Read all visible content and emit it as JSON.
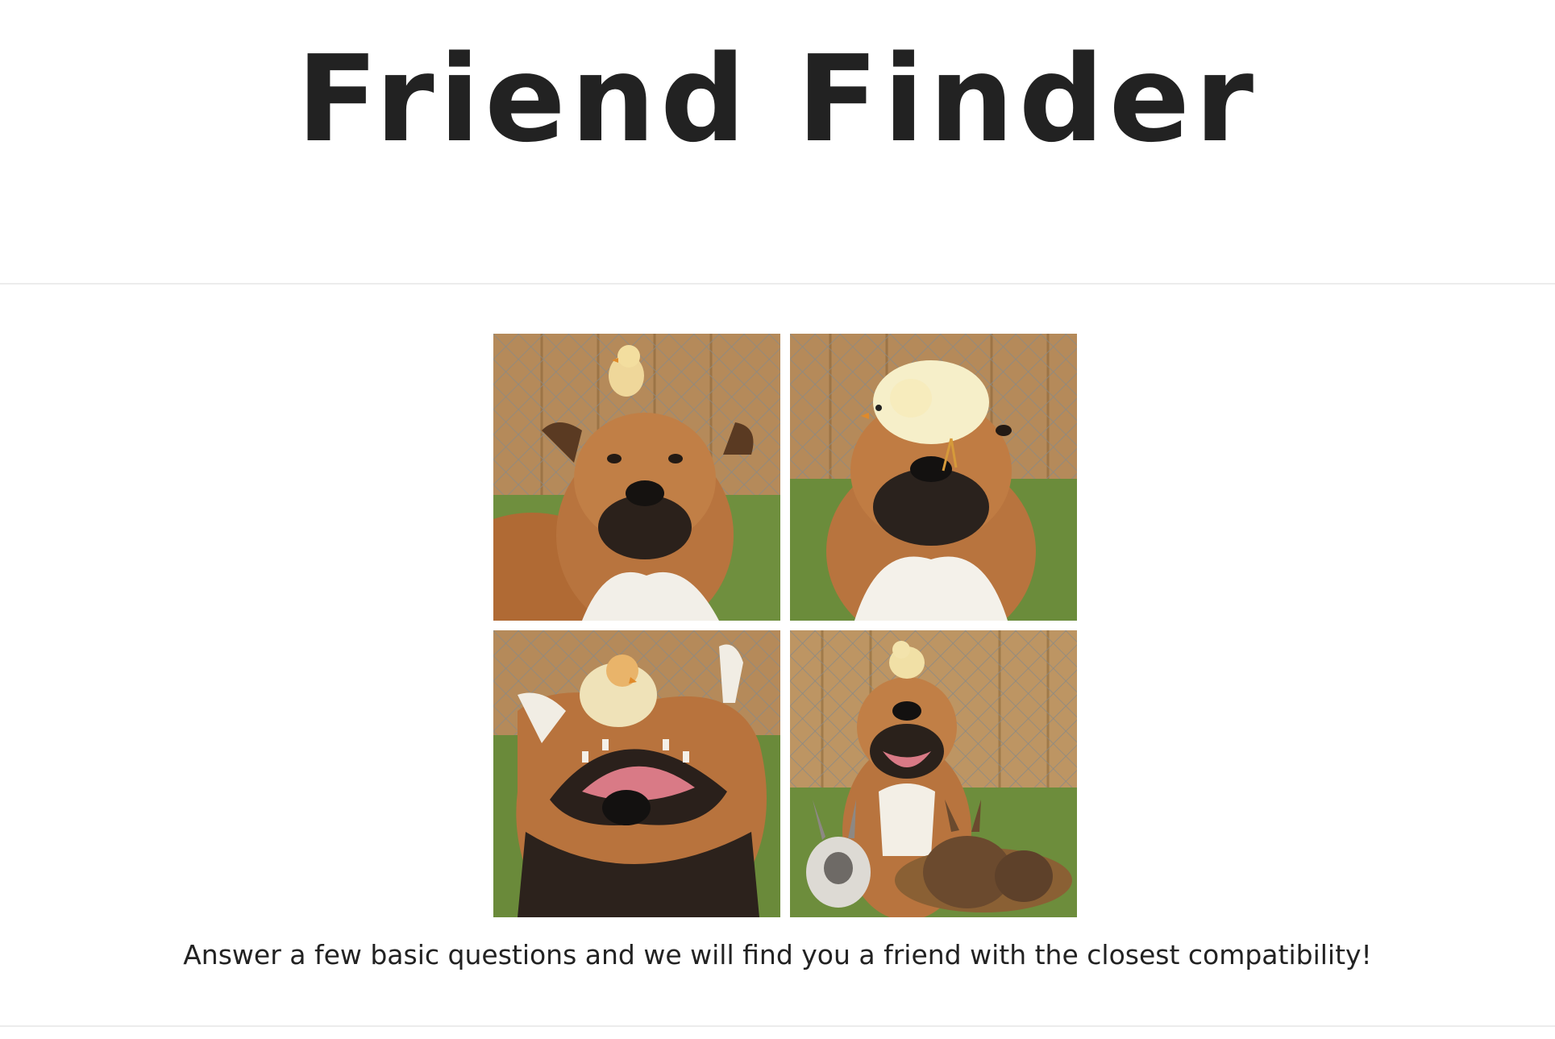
{
  "header": {
    "title": "Friend Finder"
  },
  "hero": {
    "images": [
      {
        "name": "dog-with-chick-on-head-photo"
      },
      {
        "name": "dog-with-chick-on-face-photo"
      },
      {
        "name": "dog-rolling-with-chick-photo"
      },
      {
        "name": "dog-with-chick-and-rabbits-photo"
      }
    ]
  },
  "intro": {
    "tagline": "Answer a few basic questions and we will find you a friend with the closest compatibility!"
  },
  "colors": {
    "text": "#222222",
    "divider": "#ececec",
    "background": "#ffffff"
  }
}
